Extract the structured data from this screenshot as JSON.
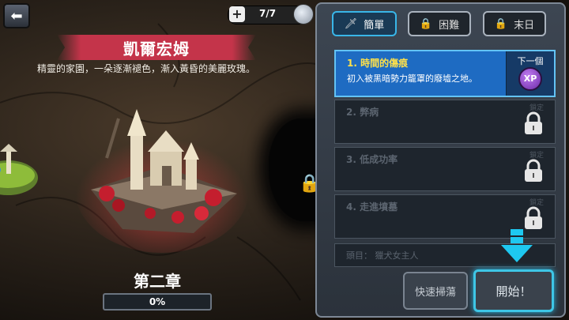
{
  "topbar": {
    "energy_count": "7/7"
  },
  "chapter": {
    "title": "凱爾宏姆",
    "description": "精靈的家園，一朵逐漸褪色，漸入黃昏的美麗玫瑰。",
    "label": "第二章",
    "progress_text": "0%",
    "progress": 0
  },
  "difficulty_tabs": [
    {
      "label": "簡單",
      "icon": "sword-icon",
      "active": true
    },
    {
      "label": "困難",
      "icon": "lock-icon",
      "active": false
    },
    {
      "label": "末日",
      "icon": "lock-icon",
      "active": false
    }
  ],
  "quests": [
    {
      "title": "1. 時間的傷痕",
      "description": "初入被黑暗勢力籠罩的廢墟之地。",
      "status": "active",
      "reward_label": "下一個",
      "reward_icon": "XP"
    },
    {
      "title": "2. 弊病",
      "status": "locked",
      "lock_label": "鎖定"
    },
    {
      "title": "3. 低成功率",
      "status": "locked",
      "lock_label": "鎖定"
    },
    {
      "title": "4. 走進墳墓",
      "status": "locked",
      "lock_label": "鎖定"
    }
  ],
  "boss": {
    "text": "頭目： 獵犬女主人"
  },
  "buttons": {
    "sweep": "快速掃蕩",
    "start": "開始！"
  },
  "colors": {
    "accent": "#39b6e8",
    "ribbon": "#c4344a",
    "quest_title_active": "#ffe14a",
    "quest_active_bg": "#1e6bc2"
  }
}
